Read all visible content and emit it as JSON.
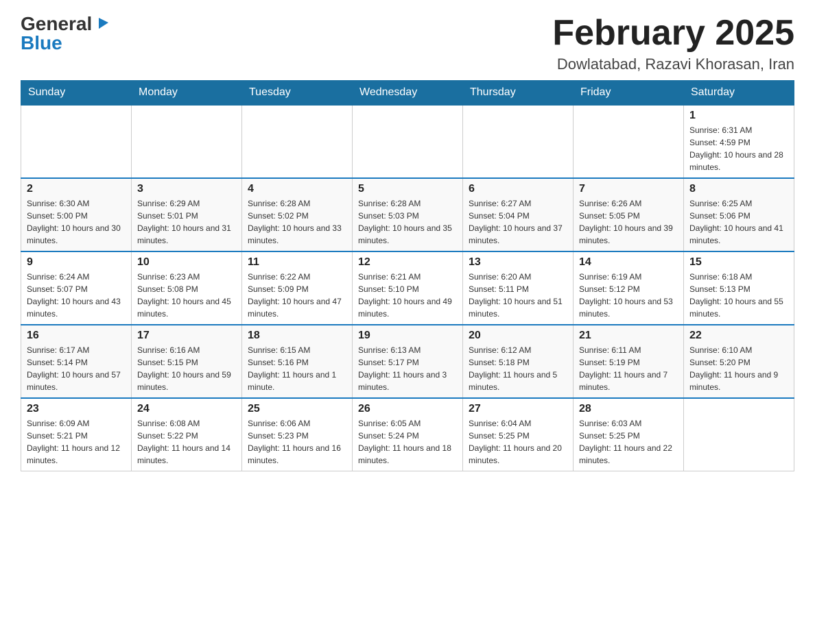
{
  "header": {
    "logo": {
      "general": "General",
      "triangle": "▶",
      "blue": "Blue"
    },
    "title": "February 2025",
    "location": "Dowlatabad, Razavi Khorasan, Iran"
  },
  "days_of_week": [
    "Sunday",
    "Monday",
    "Tuesday",
    "Wednesday",
    "Thursday",
    "Friday",
    "Saturday"
  ],
  "weeks": [
    [
      {
        "day": "",
        "info": ""
      },
      {
        "day": "",
        "info": ""
      },
      {
        "day": "",
        "info": ""
      },
      {
        "day": "",
        "info": ""
      },
      {
        "day": "",
        "info": ""
      },
      {
        "day": "",
        "info": ""
      },
      {
        "day": "1",
        "info": "Sunrise: 6:31 AM\nSunset: 4:59 PM\nDaylight: 10 hours and 28 minutes."
      }
    ],
    [
      {
        "day": "2",
        "info": "Sunrise: 6:30 AM\nSunset: 5:00 PM\nDaylight: 10 hours and 30 minutes."
      },
      {
        "day": "3",
        "info": "Sunrise: 6:29 AM\nSunset: 5:01 PM\nDaylight: 10 hours and 31 minutes."
      },
      {
        "day": "4",
        "info": "Sunrise: 6:28 AM\nSunset: 5:02 PM\nDaylight: 10 hours and 33 minutes."
      },
      {
        "day": "5",
        "info": "Sunrise: 6:28 AM\nSunset: 5:03 PM\nDaylight: 10 hours and 35 minutes."
      },
      {
        "day": "6",
        "info": "Sunrise: 6:27 AM\nSunset: 5:04 PM\nDaylight: 10 hours and 37 minutes."
      },
      {
        "day": "7",
        "info": "Sunrise: 6:26 AM\nSunset: 5:05 PM\nDaylight: 10 hours and 39 minutes."
      },
      {
        "day": "8",
        "info": "Sunrise: 6:25 AM\nSunset: 5:06 PM\nDaylight: 10 hours and 41 minutes."
      }
    ],
    [
      {
        "day": "9",
        "info": "Sunrise: 6:24 AM\nSunset: 5:07 PM\nDaylight: 10 hours and 43 minutes."
      },
      {
        "day": "10",
        "info": "Sunrise: 6:23 AM\nSunset: 5:08 PM\nDaylight: 10 hours and 45 minutes."
      },
      {
        "day": "11",
        "info": "Sunrise: 6:22 AM\nSunset: 5:09 PM\nDaylight: 10 hours and 47 minutes."
      },
      {
        "day": "12",
        "info": "Sunrise: 6:21 AM\nSunset: 5:10 PM\nDaylight: 10 hours and 49 minutes."
      },
      {
        "day": "13",
        "info": "Sunrise: 6:20 AM\nSunset: 5:11 PM\nDaylight: 10 hours and 51 minutes."
      },
      {
        "day": "14",
        "info": "Sunrise: 6:19 AM\nSunset: 5:12 PM\nDaylight: 10 hours and 53 minutes."
      },
      {
        "day": "15",
        "info": "Sunrise: 6:18 AM\nSunset: 5:13 PM\nDaylight: 10 hours and 55 minutes."
      }
    ],
    [
      {
        "day": "16",
        "info": "Sunrise: 6:17 AM\nSunset: 5:14 PM\nDaylight: 10 hours and 57 minutes."
      },
      {
        "day": "17",
        "info": "Sunrise: 6:16 AM\nSunset: 5:15 PM\nDaylight: 10 hours and 59 minutes."
      },
      {
        "day": "18",
        "info": "Sunrise: 6:15 AM\nSunset: 5:16 PM\nDaylight: 11 hours and 1 minute."
      },
      {
        "day": "19",
        "info": "Sunrise: 6:13 AM\nSunset: 5:17 PM\nDaylight: 11 hours and 3 minutes."
      },
      {
        "day": "20",
        "info": "Sunrise: 6:12 AM\nSunset: 5:18 PM\nDaylight: 11 hours and 5 minutes."
      },
      {
        "day": "21",
        "info": "Sunrise: 6:11 AM\nSunset: 5:19 PM\nDaylight: 11 hours and 7 minutes."
      },
      {
        "day": "22",
        "info": "Sunrise: 6:10 AM\nSunset: 5:20 PM\nDaylight: 11 hours and 9 minutes."
      }
    ],
    [
      {
        "day": "23",
        "info": "Sunrise: 6:09 AM\nSunset: 5:21 PM\nDaylight: 11 hours and 12 minutes."
      },
      {
        "day": "24",
        "info": "Sunrise: 6:08 AM\nSunset: 5:22 PM\nDaylight: 11 hours and 14 minutes."
      },
      {
        "day": "25",
        "info": "Sunrise: 6:06 AM\nSunset: 5:23 PM\nDaylight: 11 hours and 16 minutes."
      },
      {
        "day": "26",
        "info": "Sunrise: 6:05 AM\nSunset: 5:24 PM\nDaylight: 11 hours and 18 minutes."
      },
      {
        "day": "27",
        "info": "Sunrise: 6:04 AM\nSunset: 5:25 PM\nDaylight: 11 hours and 20 minutes."
      },
      {
        "day": "28",
        "info": "Sunrise: 6:03 AM\nSunset: 5:25 PM\nDaylight: 11 hours and 22 minutes."
      },
      {
        "day": "",
        "info": ""
      }
    ]
  ]
}
